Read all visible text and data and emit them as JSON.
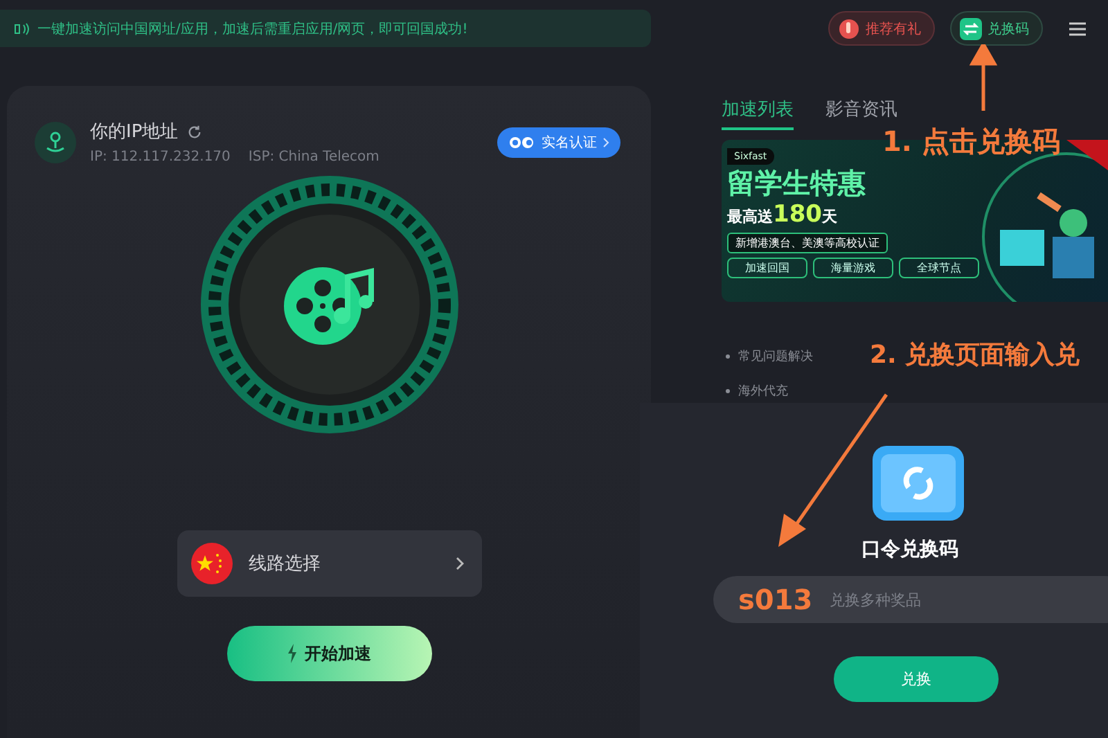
{
  "notice": {
    "text": "一键加速访问中国网址/应用，加速后需重启应用/网页，即可回国成功!"
  },
  "header_buttons": [
    {
      "kind": "referral",
      "label": "推荐有礼"
    },
    {
      "kind": "redeem",
      "label": "兑换码"
    }
  ],
  "ip_panel": {
    "title": "你的IP地址",
    "ip": "IP: 112.117.232.170",
    "isp": "ISP: China Telecom",
    "verify_button": "实名认证"
  },
  "route_select": {
    "label": "线路选择"
  },
  "start_button": "开始加速",
  "tabs": [
    {
      "label": "加速列表",
      "selected": true
    },
    {
      "label": "影音资讯",
      "selected": false
    }
  ],
  "banner": {
    "brand": "Sixfast",
    "headline": "留学生特惠",
    "offer_prefix": "最高送",
    "offer_number": "180",
    "offer_suffix": "天",
    "ribbon": "新增港澳台、美澳等高校认证",
    "chips": [
      "加速回国",
      "海量游戏",
      "全球节点"
    ]
  },
  "links": [
    "常见问题解决",
    "海外代充"
  ],
  "dialog": {
    "title": "口令兑换码",
    "field": {
      "placeholder": "兑换多种奖品"
    },
    "button": "兑换"
  },
  "annotations": [
    {
      "kind": "step",
      "text": "1. 点击兑换码"
    },
    {
      "kind": "step",
      "text": "2. 兑换页面输入兑"
    },
    {
      "kind": "code",
      "text": "s013"
    }
  ]
}
